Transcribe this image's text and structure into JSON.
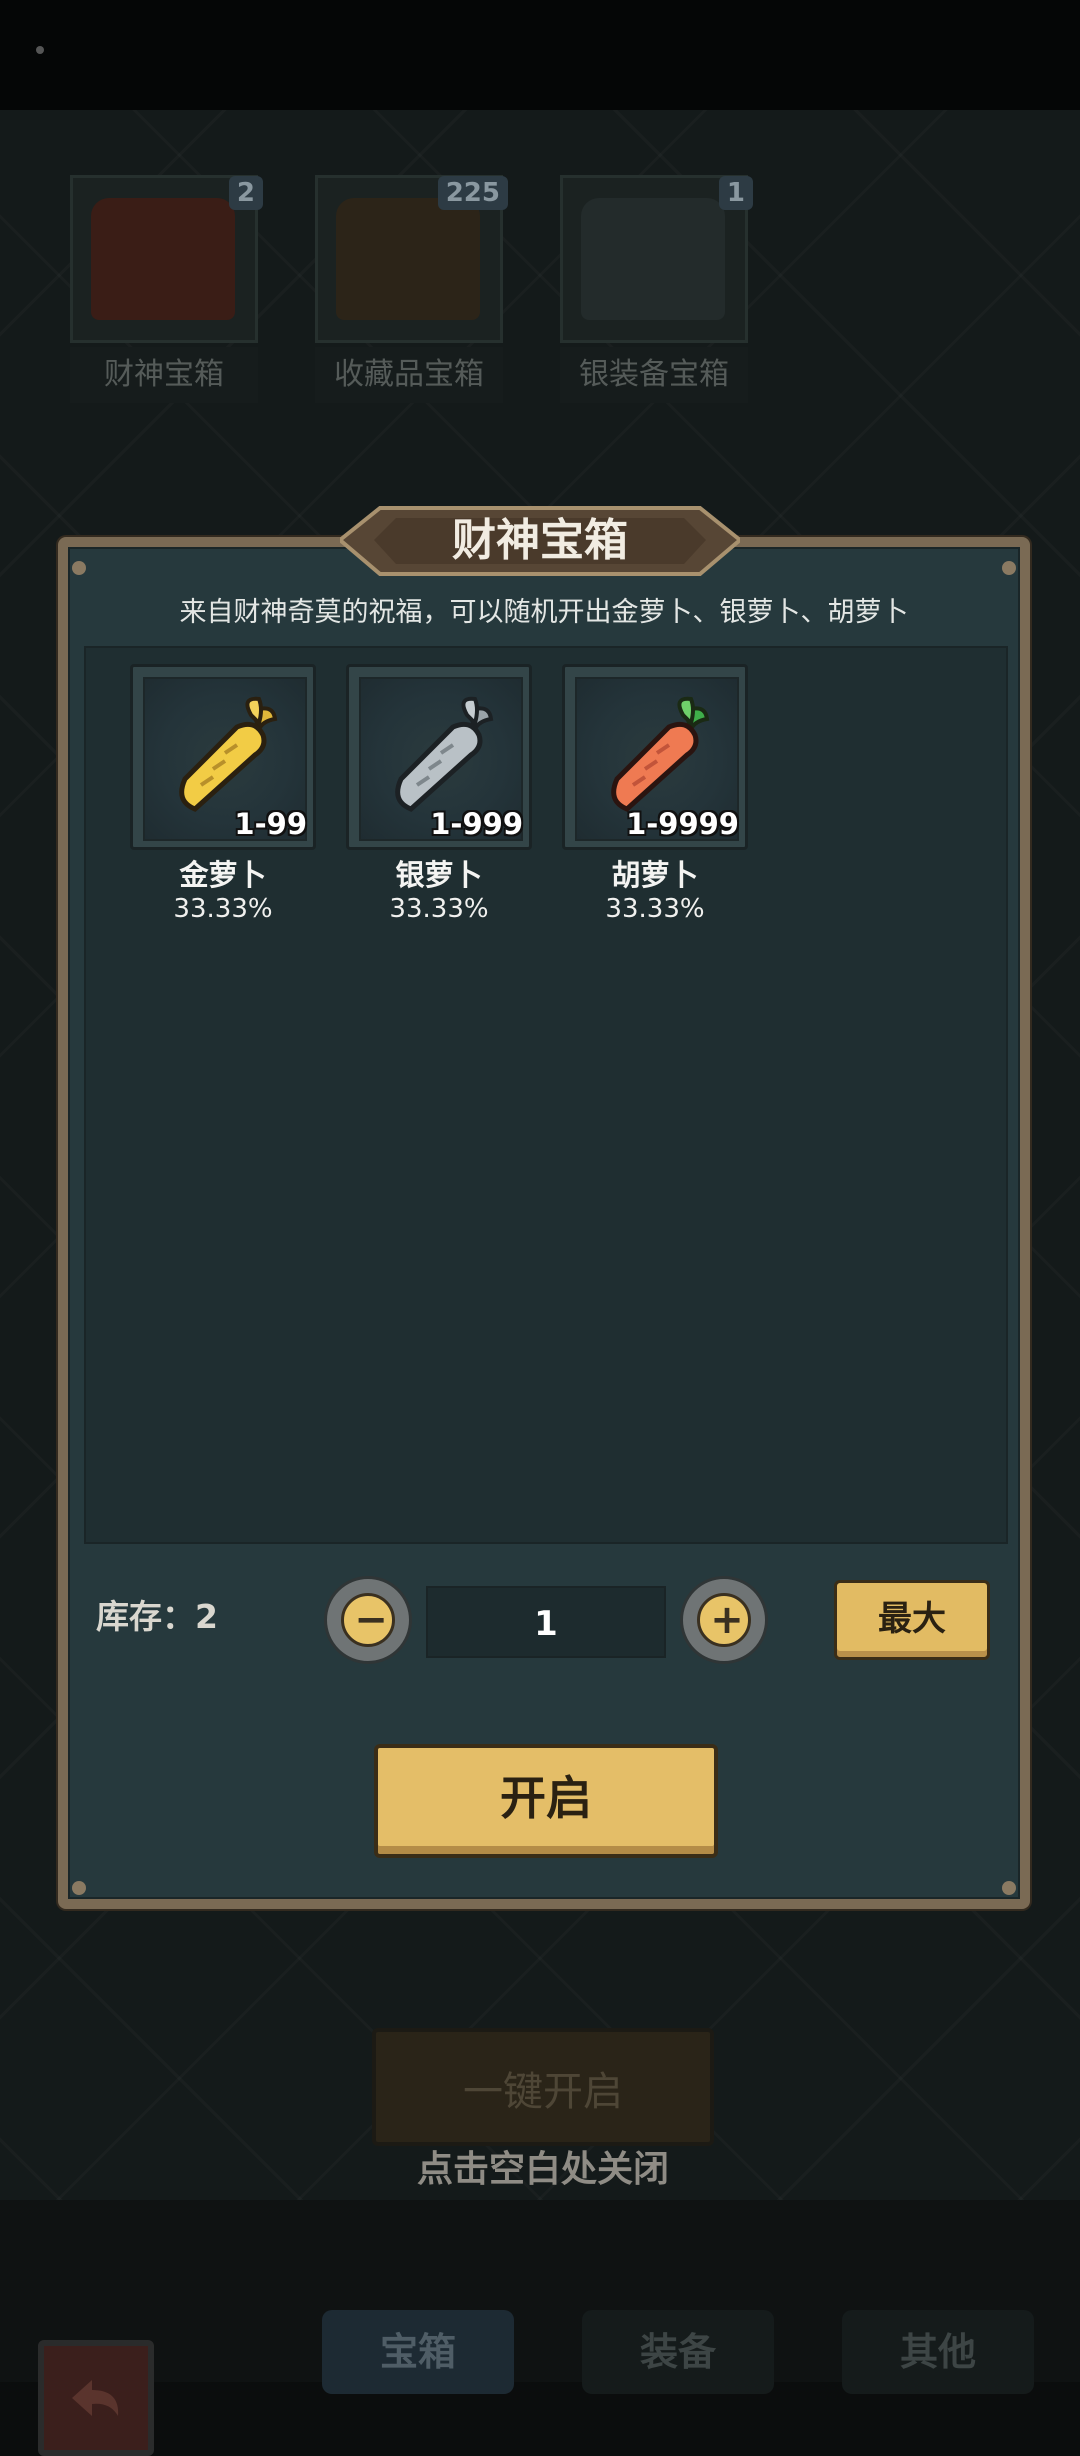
{
  "background": {
    "chests": [
      {
        "label": "财神宝箱",
        "count": "2"
      },
      {
        "label": "收藏品宝箱",
        "count": "225"
      },
      {
        "label": "银装备宝箱",
        "count": "1"
      }
    ],
    "one_key_open_label": "一键开启",
    "close_hint": "点击空白处关闭",
    "bottom_tabs": [
      {
        "label": "宝箱",
        "active": true
      },
      {
        "label": "装备",
        "active": false
      },
      {
        "label": "其他",
        "active": false
      }
    ]
  },
  "dialog": {
    "title": "财神宝箱",
    "description": "来自财神奇莫的祝福，可以随机开出金萝卜、银萝卜、胡萝卜",
    "rewards": [
      {
        "name": "金萝卜",
        "range": "1-99",
        "probability": "33.33%",
        "icon": "gold-carrot-icon",
        "color": "#f2cc45"
      },
      {
        "name": "银萝卜",
        "range": "1-999",
        "probability": "33.33%",
        "icon": "silver-carrot-icon",
        "color": "#b9c1c6"
      },
      {
        "name": "胡萝卜",
        "range": "1-9999",
        "probability": "33.33%",
        "icon": "carrot-icon",
        "color": "#ef7a52"
      }
    ],
    "stock_label": "库存：2",
    "quantity": "1",
    "minus_glyph": "−",
    "plus_glyph": "+",
    "max_label": "最大",
    "open_label": "开启"
  },
  "colors": {
    "accent": "#e4be68",
    "panel": "#26393d",
    "frame": "#7a6a54"
  }
}
